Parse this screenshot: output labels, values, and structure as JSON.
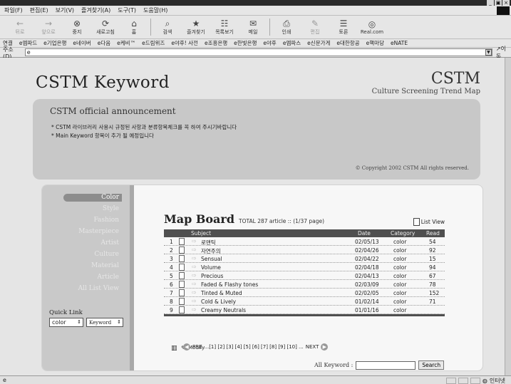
{
  "window": {
    "controls": [
      "_",
      "▣",
      "×"
    ]
  },
  "menu": [
    "파일(F)",
    "편집(E)",
    "보기(V)",
    "즐겨찾기(A)",
    "도구(T)",
    "도움말(H)"
  ],
  "toolbar": [
    {
      "label": "뒤로",
      "icon": "←",
      "dim": true
    },
    {
      "label": "앞으로",
      "icon": "→",
      "dim": true
    },
    {
      "label": "중지",
      "icon": "⊗"
    },
    {
      "label": "새로고침",
      "icon": "⟳"
    },
    {
      "label": "홈",
      "icon": "⌂"
    },
    {
      "label": "검색",
      "icon": "⌕"
    },
    {
      "label": "즐겨찾기",
      "icon": "★"
    },
    {
      "label": "목록보기",
      "icon": "☷"
    },
    {
      "label": "메일",
      "icon": "✉"
    },
    {
      "label": "인쇄",
      "icon": "⎙"
    },
    {
      "label": "편집",
      "icon": "✎",
      "dim": true
    },
    {
      "label": "토론",
      "icon": "☰"
    },
    {
      "label": "Real.com",
      "icon": "◎"
    }
  ],
  "links": {
    "label": "연결",
    "items": [
      "엠파드",
      "기업은행",
      "네이버",
      "다음",
      "케비™",
      "드림위즈",
      "야후! 사전",
      "조흥은행",
      "한빛은행",
      "야후",
      "엠파스",
      "신문가게",
      "대한항공",
      "핵마당",
      "NATE"
    ]
  },
  "address": {
    "label": "주소(D)",
    "value": "",
    "go": "이동"
  },
  "header": {
    "brand": "CSTM Keyword",
    "right_big": "CSTM",
    "right_small": "Culture Screening Trend Map"
  },
  "announce": {
    "title": "CSTM official announcement",
    "lines": [
      "* CSTM 라이브러리 사용시 규정된 사항과 분류항목체크를 꼭 하여 주시기바랍니다",
      "* Main Keyword 항목이 추가 될 예정입니다"
    ],
    "copyright": "© Copyright 2002 CSTM All rights reserved."
  },
  "nav": {
    "items": [
      "Color",
      "Style",
      "Fashion",
      "Masterpiece",
      "Artist",
      "Culture",
      "Material",
      "Article",
      "All List View"
    ],
    "quick_link": "Quick Link",
    "select1": "color",
    "select2": "Keyword"
  },
  "board": {
    "title": "Map Board",
    "total": "TOTAL 287 article :: (1/37 page)",
    "list_view": "List View",
    "columns": [
      "Subject",
      "Date",
      "Category",
      "Read"
    ],
    "rows": [
      {
        "no": "1",
        "subject": "로맨틱",
        "date": "02/05/13",
        "category": "color",
        "read": "54"
      },
      {
        "no": "2",
        "subject": "자연주의",
        "date": "02/04/26",
        "category": "color",
        "read": "92"
      },
      {
        "no": "3",
        "subject": "Sensual",
        "date": "02/04/22",
        "category": "color",
        "read": "15"
      },
      {
        "no": "4",
        "subject": "Volume",
        "date": "02/04/18",
        "category": "color",
        "read": "94"
      },
      {
        "no": "5",
        "subject": "Precious",
        "date": "02/04/13",
        "category": "color",
        "read": "67"
      },
      {
        "no": "6",
        "subject": "Faded & Flashy tones",
        "date": "02/03/09",
        "category": "color",
        "read": "78"
      },
      {
        "no": "7",
        "subject": "Tinted & Muted",
        "date": "02/02/05",
        "category": "color",
        "read": "152"
      },
      {
        "no": "8",
        "subject": "Cold & Lively",
        "date": "01/02/14",
        "category": "color",
        "read": "71"
      },
      {
        "no": "9",
        "subject": "Creamy Neutrals",
        "date": "01/01/16",
        "category": "color",
        "read": ""
      }
    ],
    "modify": "Modify",
    "prev": "PRE",
    "pages": "...[1] [2] [3] [4] [5] [6] [7] [8] [9] [10] ...",
    "next": "NEXT",
    "search_label": "All Keyword :",
    "search_button": "Search"
  },
  "status": {
    "left": "e",
    "zone": "인터넷"
  }
}
